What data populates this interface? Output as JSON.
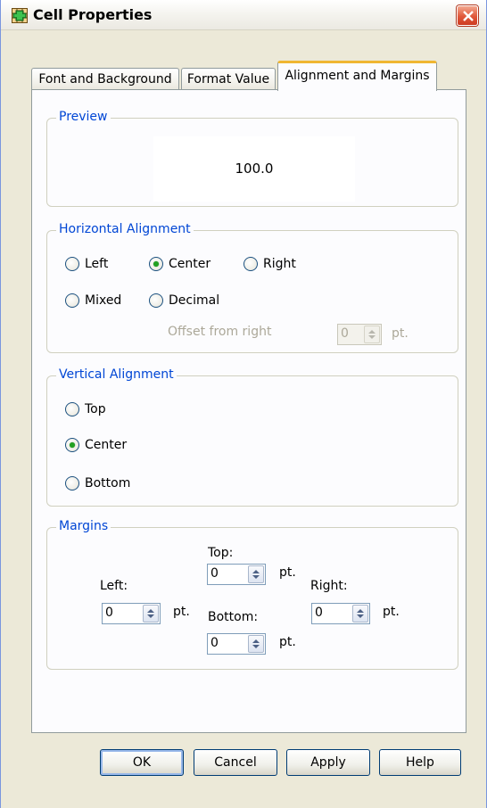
{
  "window": {
    "title": "Cell Properties"
  },
  "tabs": [
    {
      "label": "Font and Background"
    },
    {
      "label": "Format Value"
    },
    {
      "label": "Alignment and Margins"
    }
  ],
  "preview": {
    "legend": "Preview",
    "value": "100.0"
  },
  "horizontal": {
    "legend": "Horizontal Alignment",
    "options": {
      "left": "Left",
      "center": "Center",
      "right": "Right",
      "mixed": "Mixed",
      "decimal": "Decimal"
    },
    "selected": "Center",
    "offset_label": "Offset from right",
    "offset_value": "0",
    "offset_unit": "pt."
  },
  "vertical": {
    "legend": "Vertical Alignment",
    "options": {
      "top": "Top",
      "center": "Center",
      "bottom": "Bottom"
    },
    "selected": "Center"
  },
  "margins": {
    "legend": "Margins",
    "top_label": "Top:",
    "left_label": "Left:",
    "right_label": "Right:",
    "bottom_label": "Bottom:",
    "top_value": "0",
    "left_value": "0",
    "right_value": "0",
    "bottom_value": "0",
    "unit": "pt."
  },
  "buttons": {
    "ok": "OK",
    "cancel": "Cancel",
    "apply": "Apply",
    "help": "Help"
  }
}
